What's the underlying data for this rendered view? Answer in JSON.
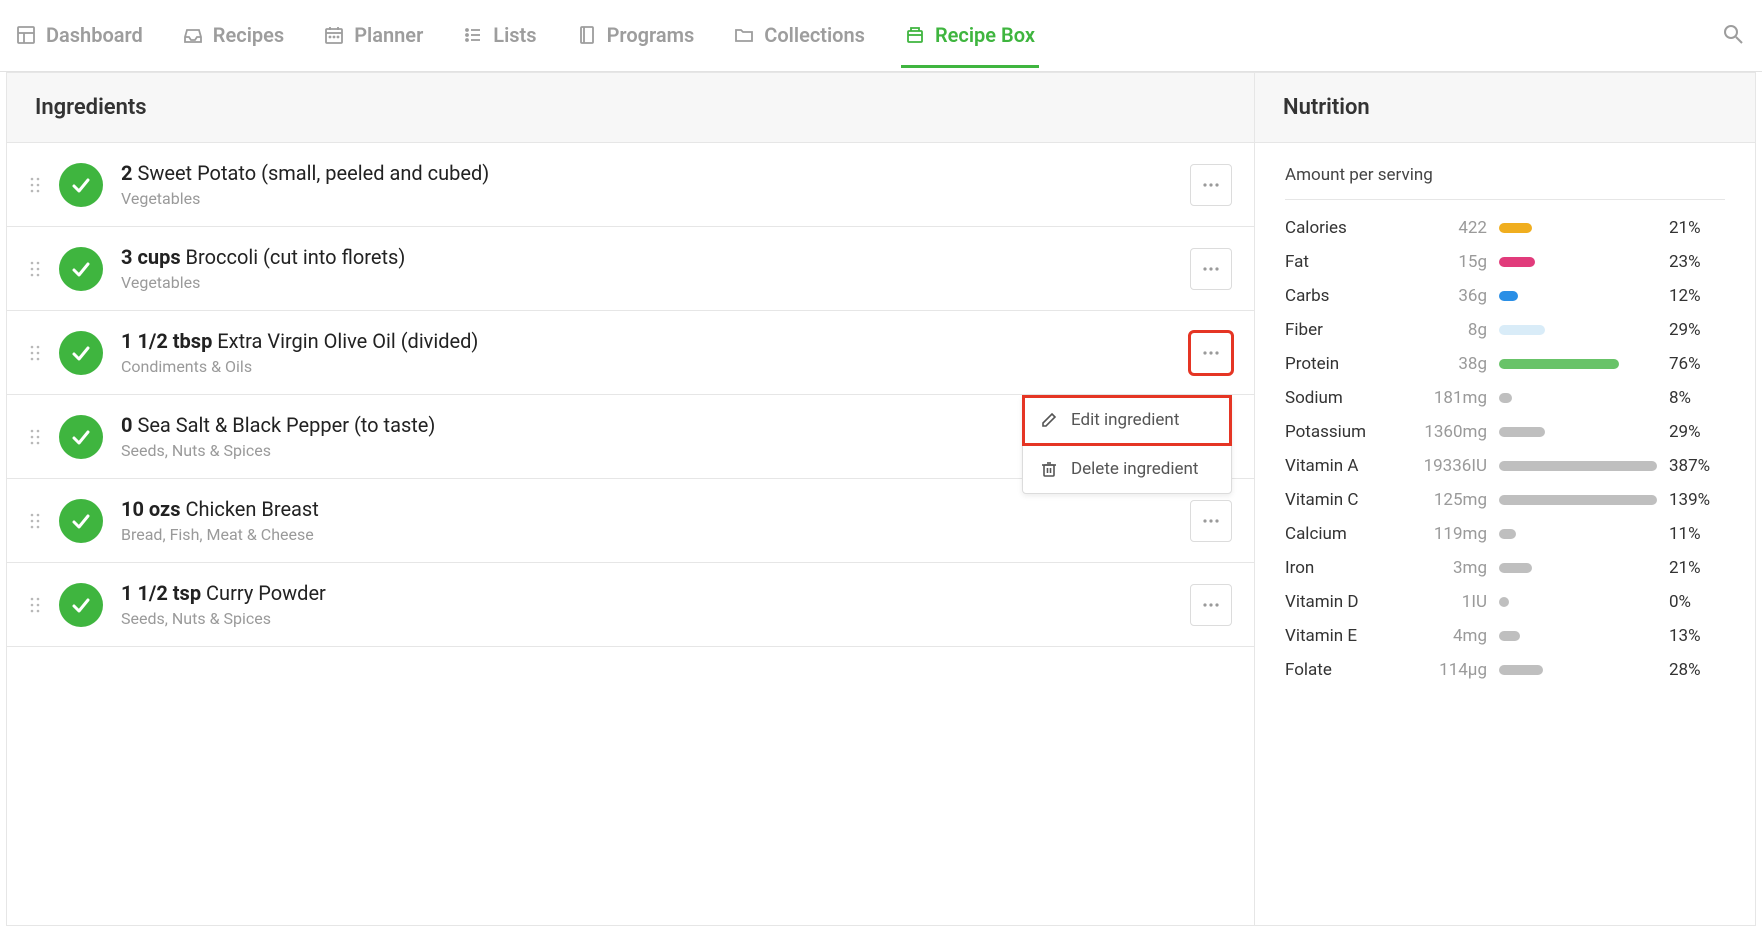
{
  "nav": {
    "items": [
      {
        "label": "Dashboard",
        "icon": "dashboard"
      },
      {
        "label": "Recipes",
        "icon": "inbox"
      },
      {
        "label": "Planner",
        "icon": "calendar"
      },
      {
        "label": "Lists",
        "icon": "lists"
      },
      {
        "label": "Programs",
        "icon": "book"
      },
      {
        "label": "Collections",
        "icon": "folder"
      },
      {
        "label": "Recipe Box",
        "icon": "recipebox",
        "active": true
      }
    ]
  },
  "headers": {
    "ingredients": "Ingredients",
    "nutrition": "Nutrition",
    "amountPerServing": "Amount per serving"
  },
  "dropdown": {
    "edit": "Edit ingredient",
    "delete": "Delete ingredient"
  },
  "ingredients": [
    {
      "amount": "2",
      "name": "Sweet Potato (small, peeled and cubed)",
      "category": "Vegetables"
    },
    {
      "amount": "3 cups",
      "name": "Broccoli (cut into florets)",
      "category": "Vegetables"
    },
    {
      "amount": "1 1/2 tbsp",
      "name": "Extra Virgin Olive Oil (divided)",
      "category": "Condiments & Oils",
      "showDropdown": true,
      "highlightMore": true
    },
    {
      "amount": "0",
      "name": "Sea Salt & Black Pepper (to taste)",
      "category": "Seeds, Nuts & Spices"
    },
    {
      "amount": "10 ozs",
      "name": "Chicken Breast",
      "category": "Bread, Fish, Meat & Cheese"
    },
    {
      "amount": "1 1/2 tsp",
      "name": "Curry Powder",
      "category": "Seeds, Nuts & Spices"
    }
  ],
  "nutrition": [
    {
      "name": "Calories",
      "value": "422",
      "pct": "21%",
      "barPct": 21,
      "color": "#f0ae1f"
    },
    {
      "name": "Fat",
      "value": "15g",
      "pct": "23%",
      "barPct": 23,
      "color": "#e13b7b"
    },
    {
      "name": "Carbs",
      "value": "36g",
      "pct": "12%",
      "barPct": 12,
      "color": "#2a8fe6"
    },
    {
      "name": "Fiber",
      "value": "8g",
      "pct": "29%",
      "barPct": 29,
      "color": "#d9ecf8"
    },
    {
      "name": "Protein",
      "value": "38g",
      "pct": "76%",
      "barPct": 76,
      "color": "#68c368"
    },
    {
      "name": "Sodium",
      "value": "181mg",
      "pct": "8%",
      "barPct": 8,
      "color": "#bfbfbf"
    },
    {
      "name": "Potassium",
      "value": "1360mg",
      "pct": "29%",
      "barPct": 29,
      "color": "#bfbfbf"
    },
    {
      "name": "Vitamin A",
      "value": "19336IU",
      "pct": "387%",
      "barPct": 100,
      "color": "#bfbfbf"
    },
    {
      "name": "Vitamin C",
      "value": "125mg",
      "pct": "139%",
      "barPct": 100,
      "color": "#bfbfbf"
    },
    {
      "name": "Calcium",
      "value": "119mg",
      "pct": "11%",
      "barPct": 11,
      "color": "#bfbfbf"
    },
    {
      "name": "Iron",
      "value": "3mg",
      "pct": "21%",
      "barPct": 21,
      "color": "#bfbfbf"
    },
    {
      "name": "Vitamin D",
      "value": "1IU",
      "pct": "0%",
      "barPct": 0,
      "color": "#bfbfbf"
    },
    {
      "name": "Vitamin E",
      "value": "4mg",
      "pct": "13%",
      "barPct": 13,
      "color": "#bfbfbf"
    },
    {
      "name": "Folate",
      "value": "114µg",
      "pct": "28%",
      "barPct": 28,
      "color": "#bfbfbf"
    }
  ]
}
